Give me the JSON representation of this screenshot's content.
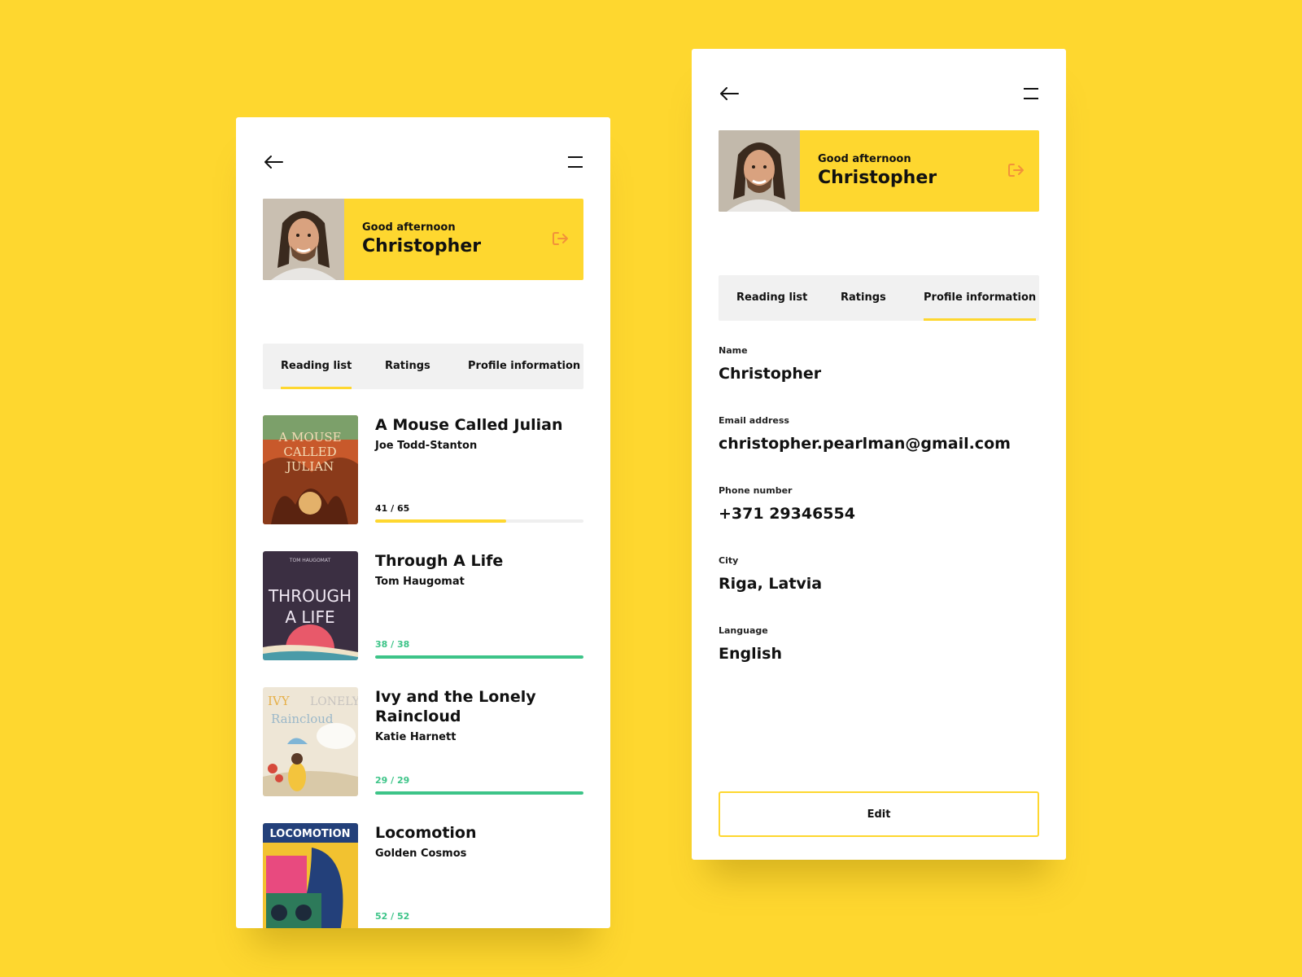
{
  "colors": {
    "background": "#FED72F",
    "accent": "#FED72F",
    "complete": "#3DC488",
    "logout": "#F2913A"
  },
  "greeting": {
    "small": "Good afternoon",
    "name": "Christopher"
  },
  "tabs": [
    "Reading list",
    "Ratings",
    "Profile information"
  ],
  "reading_list": [
    {
      "title": "A Mouse Called Julian",
      "author": "Joe Todd-Stanton",
      "progress_text": "41 / 65",
      "progress": 0.63,
      "complete": false,
      "cover_text": "A MOUSE CALLED JULIAN"
    },
    {
      "title": "Through A Life",
      "author": "Tom Haugomat",
      "progress_text": "38 / 38",
      "progress": 1,
      "complete": true,
      "cover_text": "THROUGH A LIFE",
      "cover_author": "TOM HAUGOMAT"
    },
    {
      "title": "Ivy and the Lonely Raincloud",
      "author": "Katie Harnett",
      "progress_text": "29 / 29",
      "progress": 1,
      "complete": true,
      "cover_text": "IVY and the LONELY Raincloud"
    },
    {
      "title": "Locomotion",
      "author": "Golden Cosmos",
      "progress_text": "52 / 52",
      "progress": 1,
      "complete": true,
      "cover_text": "LOCOMOTION"
    }
  ],
  "profile": {
    "name_label": "Name",
    "name": "Christopher",
    "email_label": "Email address",
    "email": "christopher.pearlman@gmail.com",
    "phone_label": "Phone number",
    "phone": "+371 29346554",
    "city_label": "City",
    "city": "Riga, Latvia",
    "language_label": "Language",
    "language": "English"
  },
  "edit_label": "Edit",
  "icons": {
    "back": "arrow-left-icon",
    "menu": "menu-icon",
    "logout": "logout-icon"
  }
}
